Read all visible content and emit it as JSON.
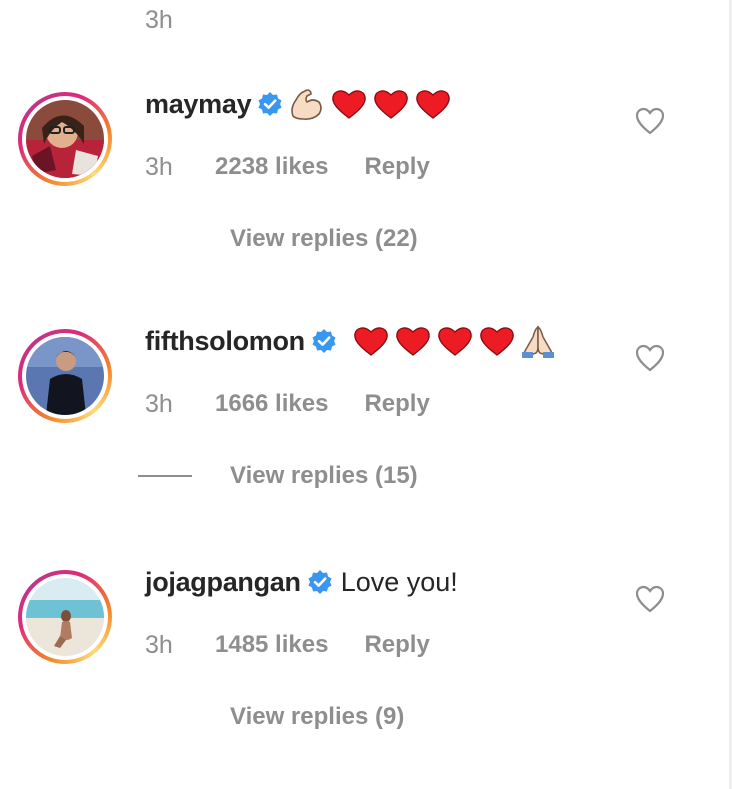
{
  "top": {
    "time": "3h"
  },
  "comments": [
    {
      "username": "maymay",
      "verified": true,
      "emojis": [
        "flexed-biceps",
        "red-heart",
        "red-heart",
        "red-heart"
      ],
      "text": "",
      "time": "3h",
      "likes": "2238 likes",
      "reply": "Reply",
      "view_replies": "View replies (22)"
    },
    {
      "username": "fifthsolomon",
      "verified": true,
      "emojis": [
        "red-heart",
        "red-heart",
        "red-heart",
        "red-heart",
        "folded-hands"
      ],
      "text": "",
      "time": "3h",
      "likes": "1666 likes",
      "reply": "Reply",
      "view_replies": "View replies (15)"
    },
    {
      "username": "jojagpangan",
      "verified": true,
      "emojis": [],
      "text": "Love you!",
      "time": "3h",
      "likes": "1485 likes",
      "reply": "Reply",
      "view_replies": "View replies (9)"
    }
  ],
  "colors": {
    "verified": "#3897f0",
    "heart": "#ed1c24",
    "muted": "#8e8e8e",
    "text": "#262626"
  }
}
